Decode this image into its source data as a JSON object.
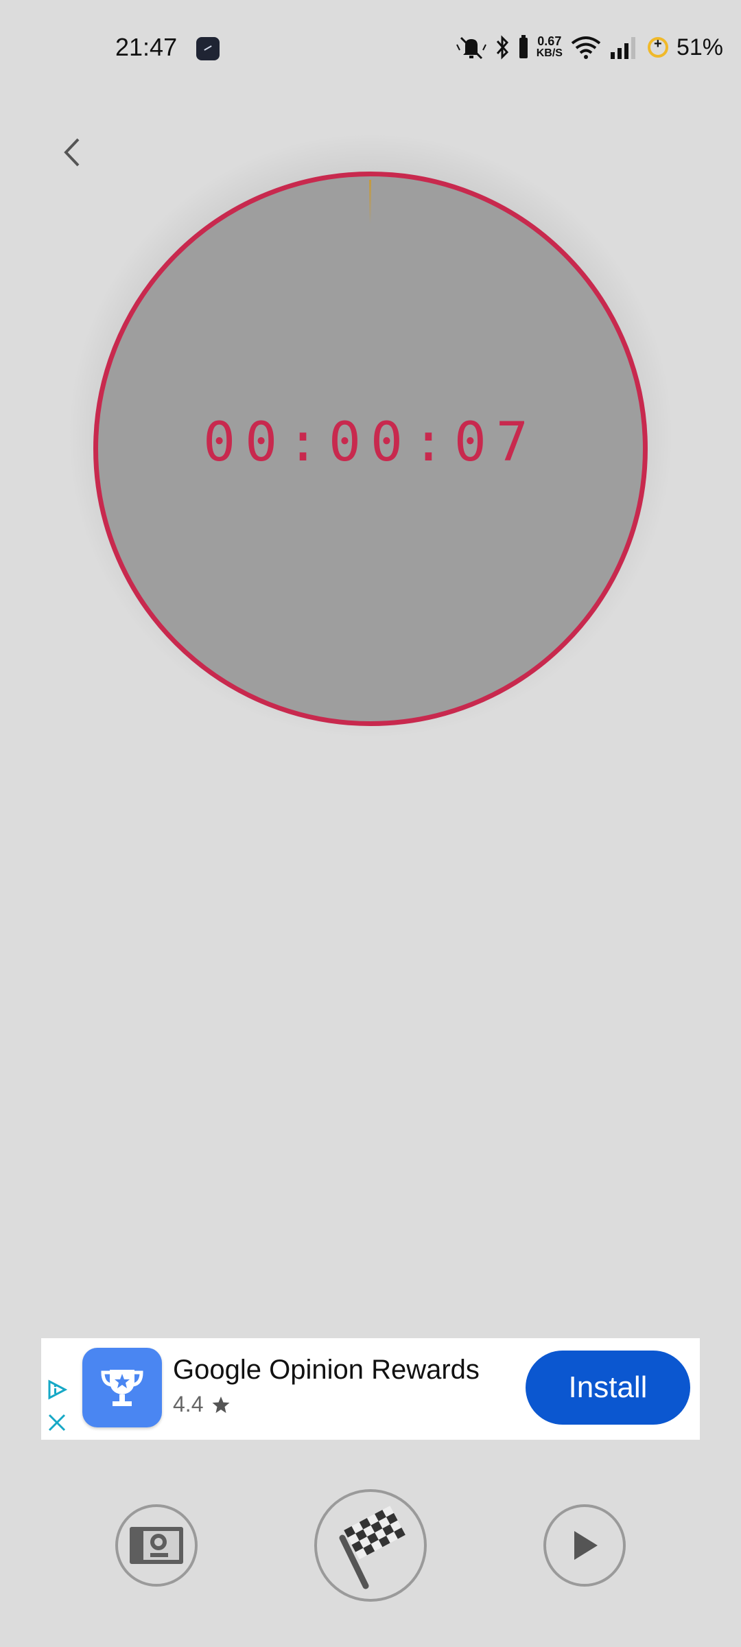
{
  "status_bar": {
    "time": "21:47",
    "net_speed_value": "0.67",
    "net_speed_unit": "KB/S",
    "battery": "51%"
  },
  "timer": {
    "display": "00:00:07",
    "ring_color": "#c8294e",
    "face_color": "#9e9e9e"
  },
  "ad": {
    "title": "Google Opinion Rewards",
    "rating": "4.4",
    "install_label": "Install",
    "button_color": "#0b57d0"
  },
  "controls": {
    "left_icon": "screen-icon",
    "center_icon": "checkered-flag-icon",
    "right_icon": "play-icon"
  }
}
